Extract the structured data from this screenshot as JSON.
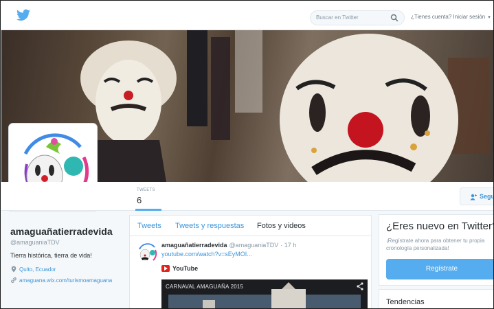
{
  "topbar": {
    "logo_icon": "twitter-bird-icon",
    "search_placeholder": "Buscar en Twitter",
    "search_icon": "search-icon",
    "login_text": "¿Tienes cuenta? Iniciar sesión",
    "login_caret": "▾"
  },
  "profile": {
    "display_name": "amaguañatierradevida",
    "handle": "@amaguaniaTDV",
    "bio": "Tierra histórica, tierra de vida!",
    "location": "Quito, Ecuador",
    "website": "amaguana.wix.com/turismoamaguana",
    "location_icon": "location-pin-icon",
    "link_icon": "link-icon"
  },
  "stats": {
    "tweets_label": "TWEETS",
    "tweets_value": "6",
    "follow_label": "Seguir",
    "follow_icon": "add-user-icon"
  },
  "timeline": {
    "tabs": [
      {
        "label": "Tweets",
        "active": false
      },
      {
        "label": "Tweets y respuestas",
        "active": false
      },
      {
        "label": "Fotos y videos",
        "active": true
      }
    ],
    "tweet": {
      "author": "amaguañatierradevida",
      "handle": "@amaguaniaTDV",
      "time": "· 17 h",
      "link": "youtube.com/watch?v=sEyMOI...",
      "card_source": "YouTube",
      "video_title": "CARNAVAL AMAGUAÑA 2015"
    }
  },
  "sidebar": {
    "signup_title": "¿Eres nuevo en Twitter?",
    "signup_subtitle": "¡Regístrate ahora para obtener tu propia cronología personalizada!",
    "signup_button": "Regístrate",
    "trends_title": "Tendencias"
  },
  "colors": {
    "brand_blue": "#55acee",
    "link_blue": "#3b94d9",
    "youtube_red": "#e62117"
  }
}
